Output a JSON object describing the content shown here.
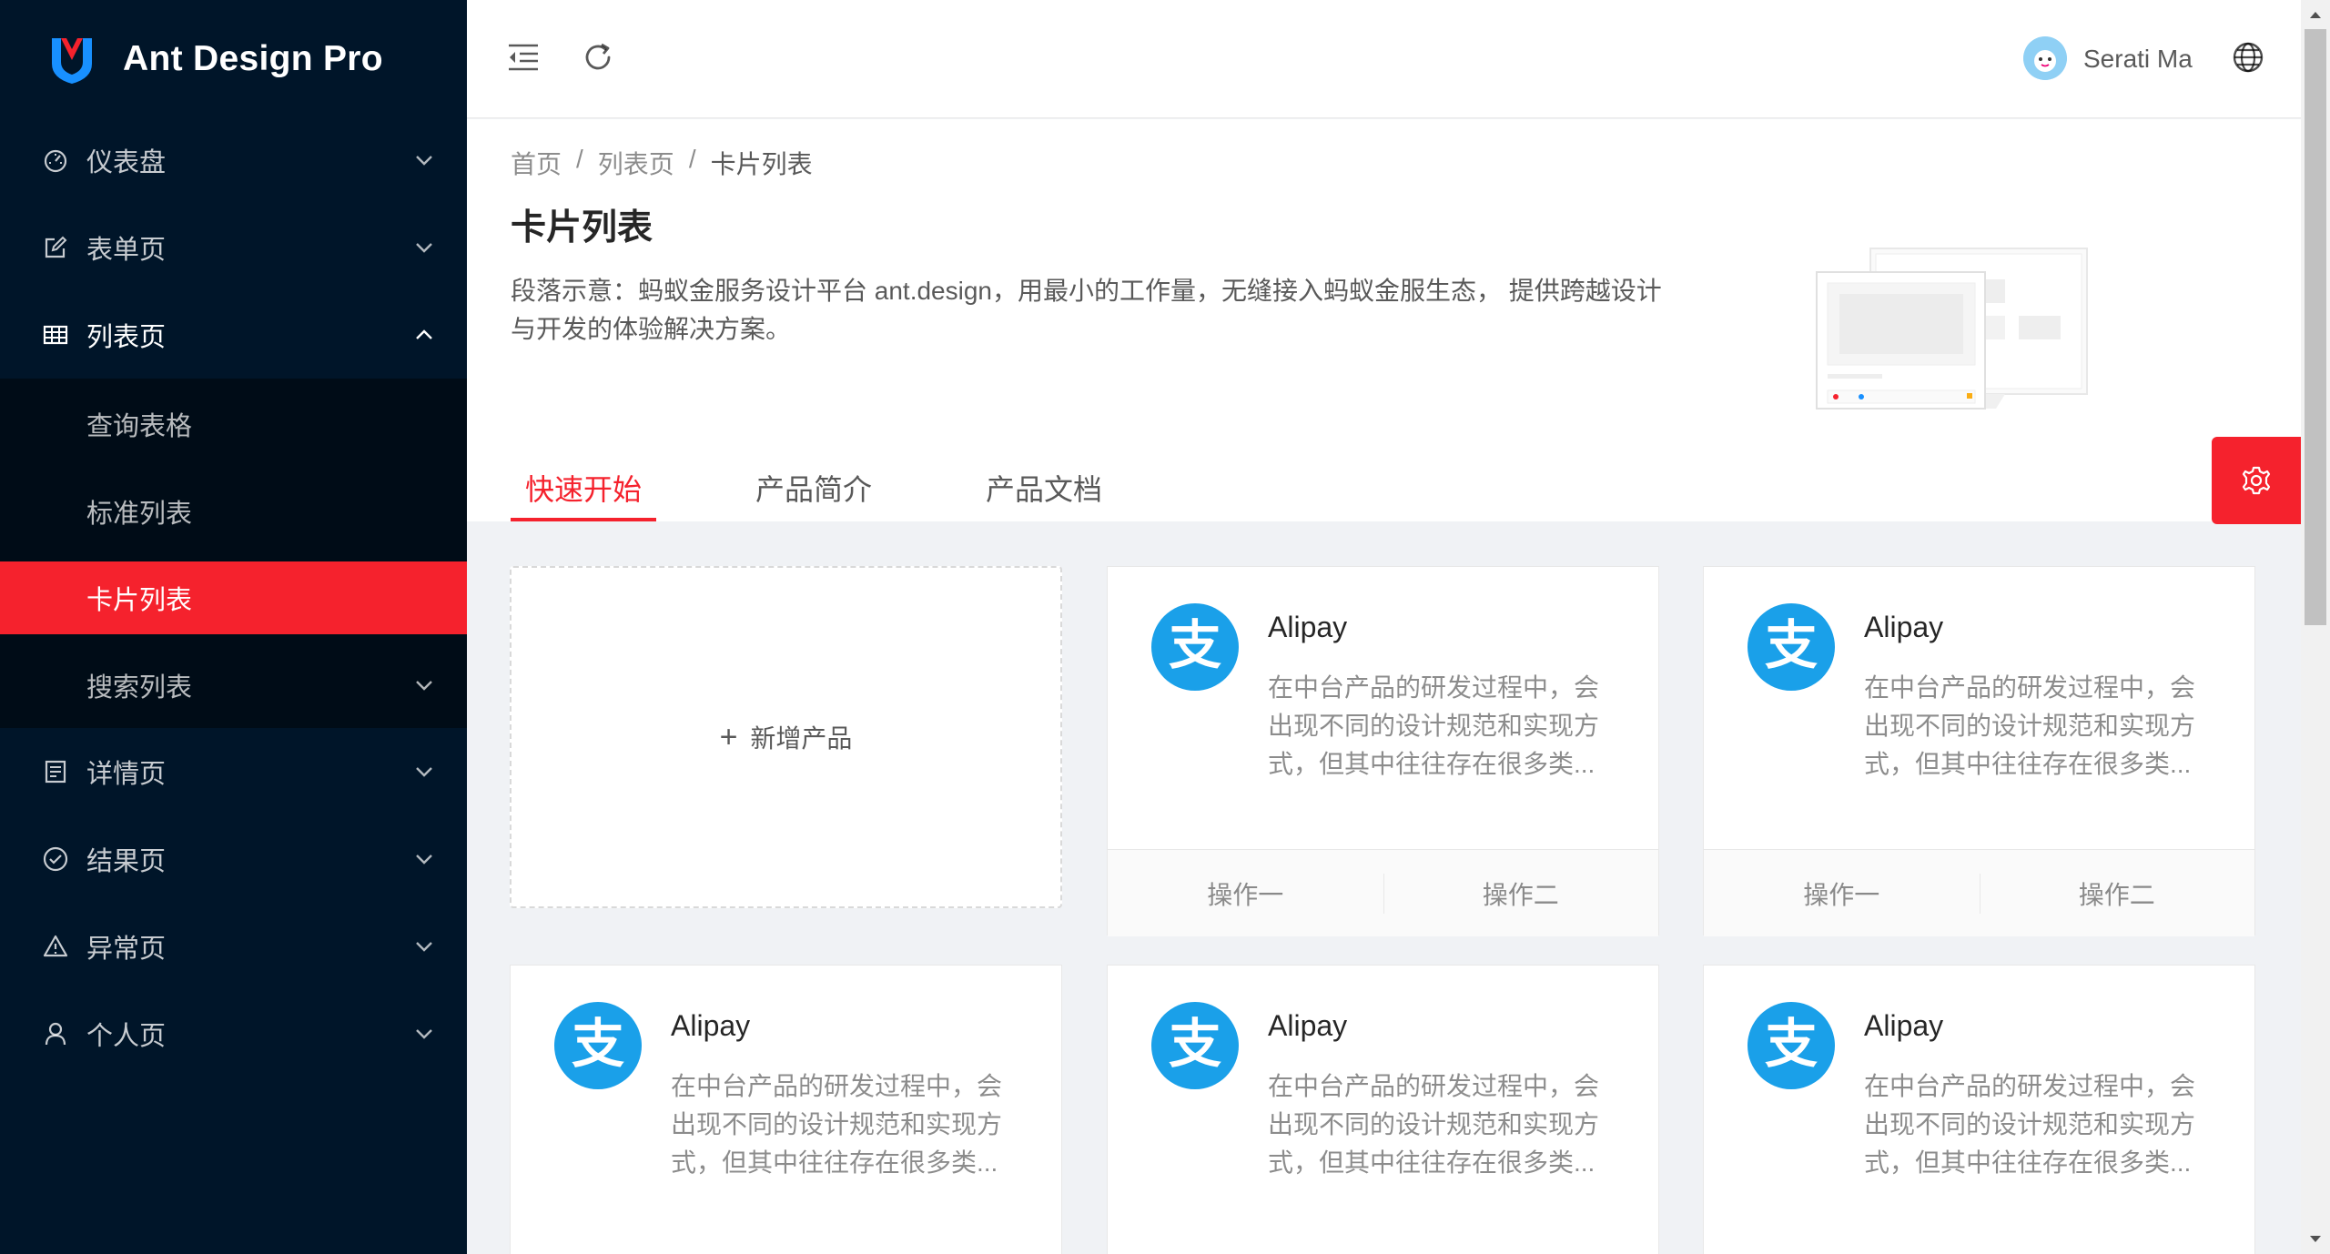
{
  "app": {
    "title": "Ant Design Pro"
  },
  "sidebar": {
    "items": [
      {
        "label": "仪表盘",
        "icon": "dashboard-icon"
      },
      {
        "label": "表单页",
        "icon": "form-icon"
      },
      {
        "label": "列表页",
        "icon": "table-icon"
      },
      {
        "label": "查询表格"
      },
      {
        "label": "标准列表"
      },
      {
        "label": "卡片列表"
      },
      {
        "label": "搜索列表"
      },
      {
        "label": "详情页",
        "icon": "profile-icon"
      },
      {
        "label": "结果页",
        "icon": "check-circle-icon"
      },
      {
        "label": "异常页",
        "icon": "warning-icon"
      },
      {
        "label": "个人页",
        "icon": "user-icon"
      }
    ],
    "selected": "卡片列表"
  },
  "header": {
    "username": "Serati Ma"
  },
  "breadcrumb": [
    "首页",
    "列表页",
    "卡片列表"
  ],
  "page": {
    "title": "卡片列表",
    "description": "段落示意：蚂蚁金服务设计平台 ant.design，用最小的工作量，无缝接入蚂蚁金服生态， 提供跨越设计与开发的体验解决方案。"
  },
  "tabs": [
    {
      "label": "快速开始",
      "active": true
    },
    {
      "label": "产品简介",
      "active": false
    },
    {
      "label": "产品文档",
      "active": false
    }
  ],
  "new_card": {
    "label": "新增产品"
  },
  "cards": [
    {
      "title": "Alipay",
      "desc": "在中台产品的研发过程中，会出现不同的设计规范和实现方式，但其中往往存在很多类...",
      "action1": "操作一",
      "action2": "操作二"
    },
    {
      "title": "Alipay",
      "desc": "在中台产品的研发过程中，会出现不同的设计规范和实现方式，但其中往往存在很多类...",
      "action1": "操作一",
      "action2": "操作二"
    },
    {
      "title": "Alipay",
      "desc": "在中台产品的研发过程中，会出现不同的设计规范和实现方式，但其中往往存在很多类..."
    },
    {
      "title": "Alipay",
      "desc": "在中台产品的研发过程中，会出现不同的设计规范和实现方式，但其中往往存在很多类..."
    },
    {
      "title": "Alipay",
      "desc": "在中台产品的研发过程中，会出现不同的设计规范和实现方式，但其中往往存在很多类..."
    }
  ],
  "colors": {
    "primary": "#f5222d",
    "sider": "#001529",
    "submenu": "#000c17",
    "alipay": "#1aa0e9"
  }
}
